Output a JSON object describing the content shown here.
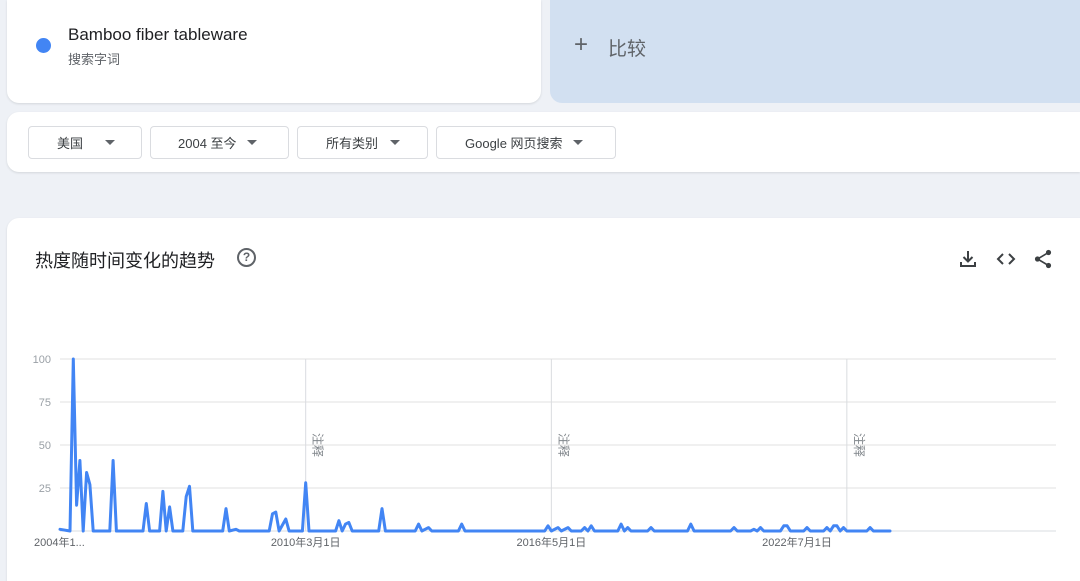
{
  "search_term": {
    "title": "Bamboo fiber tableware",
    "subtitle": "搜索字词",
    "color": "#4285f4"
  },
  "compare": {
    "plus_glyph": "+",
    "label": "比较"
  },
  "filters": [
    {
      "label": "美国"
    },
    {
      "label": "2004 至今"
    },
    {
      "label": "所有类别"
    },
    {
      "label": "Google 网页搜索"
    }
  ],
  "chart_header": {
    "title": "热度随时间变化的趋势",
    "help_glyph": "?",
    "icons": [
      "download-icon",
      "embed-code-icon",
      "share-icon"
    ]
  },
  "chart_data": {
    "type": "line",
    "title": "热度随时间变化的趋势",
    "xlabel": "",
    "ylabel": "",
    "ylim": [
      0,
      100
    ],
    "yticks": [
      25,
      50,
      75,
      100
    ],
    "grid": true,
    "xticks": [
      {
        "label": "2004年1...",
        "month": 0
      },
      {
        "label": "2010年3月1日",
        "month": 74
      },
      {
        "label": "2016年5月1日",
        "month": 148
      },
      {
        "label": "2022年7月1日",
        "month": 222
      }
    ],
    "annotation_text": "注释",
    "annotation_months": [
      74,
      148,
      237
    ],
    "x_range_months": [
      0,
      300
    ],
    "series": [
      {
        "color": "#4285f4",
        "points": [
          [
            0,
            1
          ],
          [
            3,
            0
          ],
          [
            4,
            100
          ],
          [
            5,
            15
          ],
          [
            6,
            41
          ],
          [
            7,
            0
          ],
          [
            8,
            34
          ],
          [
            9,
            27
          ],
          [
            10,
            0
          ],
          [
            15,
            0
          ],
          [
            16,
            41
          ],
          [
            17,
            0
          ],
          [
            25,
            0
          ],
          [
            26,
            16
          ],
          [
            27,
            0
          ],
          [
            30,
            0
          ],
          [
            31,
            23
          ],
          [
            32,
            0
          ],
          [
            33,
            14
          ],
          [
            34,
            0
          ],
          [
            37,
            0
          ],
          [
            38,
            20
          ],
          [
            39,
            26
          ],
          [
            40,
            0
          ],
          [
            49,
            0
          ],
          [
            50,
            13
          ],
          [
            51,
            0
          ],
          [
            53,
            1
          ],
          [
            54,
            0
          ],
          [
            63,
            0
          ],
          [
            64,
            10
          ],
          [
            65,
            11
          ],
          [
            66,
            0
          ],
          [
            68,
            7
          ],
          [
            69,
            0
          ],
          [
            73,
            0
          ],
          [
            74,
            28
          ],
          [
            75,
            0
          ],
          [
            83,
            0
          ],
          [
            84,
            6
          ],
          [
            85,
            0
          ],
          [
            86,
            4
          ],
          [
            87,
            5
          ],
          [
            88,
            0
          ],
          [
            96,
            0
          ],
          [
            97,
            13
          ],
          [
            98,
            0
          ],
          [
            107,
            0
          ],
          [
            108,
            4
          ],
          [
            109,
            0
          ],
          [
            111,
            2
          ],
          [
            112,
            0
          ],
          [
            120,
            0
          ],
          [
            121,
            4
          ],
          [
            122,
            0
          ],
          [
            146,
            0
          ],
          [
            147,
            3
          ],
          [
            148,
            0
          ],
          [
            150,
            2
          ],
          [
            151,
            0
          ],
          [
            153,
            2
          ],
          [
            154,
            0
          ],
          [
            157,
            0
          ],
          [
            158,
            2
          ],
          [
            159,
            0
          ],
          [
            160,
            3
          ],
          [
            161,
            0
          ],
          [
            168,
            0
          ],
          [
            169,
            4
          ],
          [
            170,
            0
          ],
          [
            171,
            2
          ],
          [
            172,
            0
          ],
          [
            177,
            0
          ],
          [
            178,
            2
          ],
          [
            179,
            0
          ],
          [
            189,
            0
          ],
          [
            190,
            4
          ],
          [
            191,
            0
          ],
          [
            202,
            0
          ],
          [
            203,
            2
          ],
          [
            204,
            0
          ],
          [
            208,
            0
          ],
          [
            209,
            1
          ],
          [
            210,
            0
          ],
          [
            211,
            2
          ],
          [
            212,
            0
          ],
          [
            217,
            0
          ],
          [
            218,
            3
          ],
          [
            219,
            3
          ],
          [
            220,
            0
          ],
          [
            224,
            0
          ],
          [
            225,
            2
          ],
          [
            226,
            0
          ],
          [
            230,
            0
          ],
          [
            231,
            2
          ],
          [
            232,
            0
          ],
          [
            233,
            3
          ],
          [
            234,
            3
          ],
          [
            235,
            0
          ],
          [
            236,
            2
          ],
          [
            237,
            0
          ],
          [
            243,
            0
          ],
          [
            244,
            2
          ],
          [
            245,
            0
          ],
          [
            250,
            0
          ]
        ]
      }
    ]
  }
}
